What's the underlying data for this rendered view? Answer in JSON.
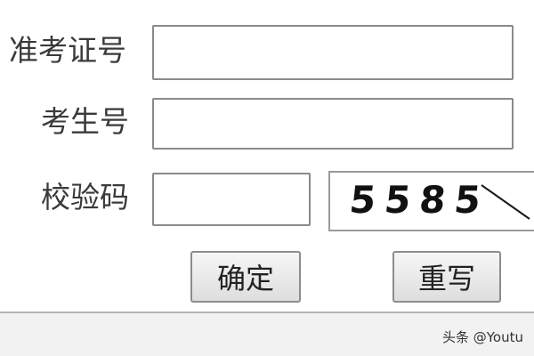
{
  "form": {
    "ticket_label": "准考证号",
    "ticket_value": "",
    "examinee_label": "考生号",
    "examinee_value": "",
    "captcha_label": "校验码",
    "captcha_value": "",
    "captcha_image_text": "5585",
    "confirm_label": "确定",
    "reset_label": "重写"
  },
  "footer": {
    "watermark": "头条 @Youtu"
  }
}
